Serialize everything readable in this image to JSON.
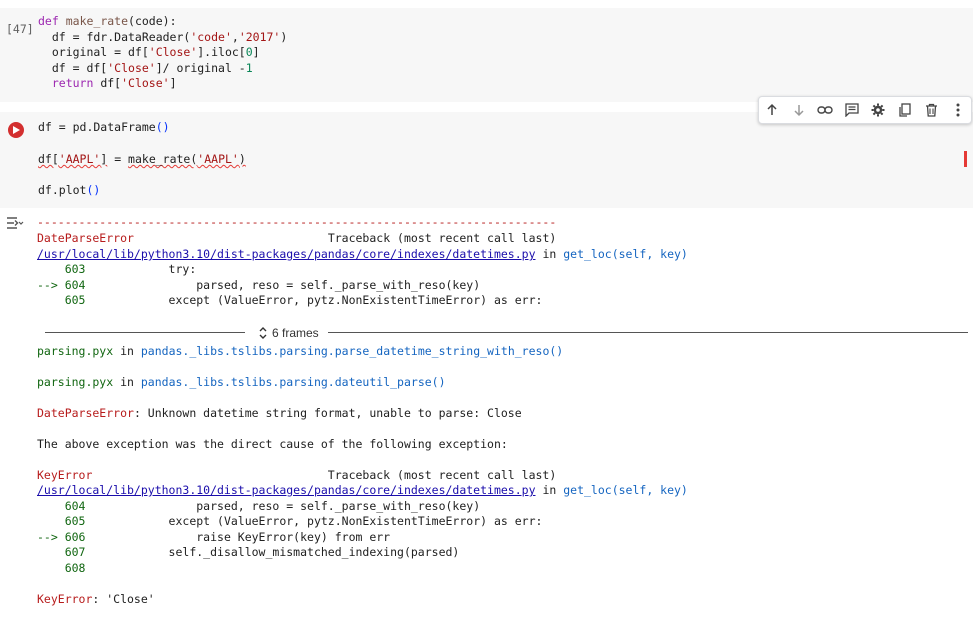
{
  "cell1": {
    "exec_count": "[47]",
    "lines": [
      "def make_rate(code):",
      "  df = fdr.DataReader('code','2017')",
      "  original = df['Close'].iloc[0]",
      "  df = df['Close']/ original -1",
      "  return df['Close']"
    ]
  },
  "cell2": {
    "lines": [
      "df = pd.DataFrame()",
      "df['AAPL'] = make_rate('AAPL')",
      "df.plot()"
    ]
  },
  "toolbar": {
    "icons": [
      "arrow-up-icon",
      "arrow-down-icon",
      "link-icon",
      "comment-icon",
      "gear-icon",
      "mirror-cell-icon",
      "trash-icon",
      "more-vert-icon"
    ]
  },
  "output": {
    "dashes": "---------------------------------------------------------------------------",
    "err1_name": "DateParseError",
    "traceback_label": "Traceback (most recent call last)",
    "path": "/usr/local/lib/python3.10/dist-packages/pandas/core/indexes/datetimes.py",
    "in_word": "in",
    "func": "get_loc(self, key)",
    "block1": [
      {
        "gutter": "    603",
        "code": "            try:"
      },
      {
        "gutter": "--> 604",
        "code": "                parsed, reso = self._parse_with_reso(key)"
      },
      {
        "gutter": "    605",
        "code": "            except (ValueError, pytz.NonExistentTimeError) as err:"
      }
    ],
    "frames_label": "6 frames",
    "parsing1_file": "parsing.pyx",
    "parsing1_func": "pandas._libs.tslibs.parsing.parse_datetime_string_with_reso()",
    "parsing2_file": "parsing.pyx",
    "parsing2_func": "pandas._libs.tslibs.parsing.dateutil_parse()",
    "err1_msg_name": "DateParseError",
    "err1_msg": ": Unknown datetime string format, unable to parse: Close",
    "cause": "The above exception was the direct cause of the following exception:",
    "err2_name": "KeyError",
    "block2": [
      {
        "gutter": "    604",
        "code": "                parsed, reso = self._parse_with_reso(key)"
      },
      {
        "gutter": "    605",
        "code": "            except (ValueError, pytz.NonExistentTimeError) as err:"
      },
      {
        "gutter": "--> 606",
        "code": "                raise KeyError(key) from err"
      },
      {
        "gutter": "    607",
        "code": "            self._disallow_mismatched_indexing(parsed)"
      },
      {
        "gutter": "    608",
        "code": ""
      }
    ],
    "final_name": "KeyError",
    "final_msg": ": 'Close'"
  }
}
